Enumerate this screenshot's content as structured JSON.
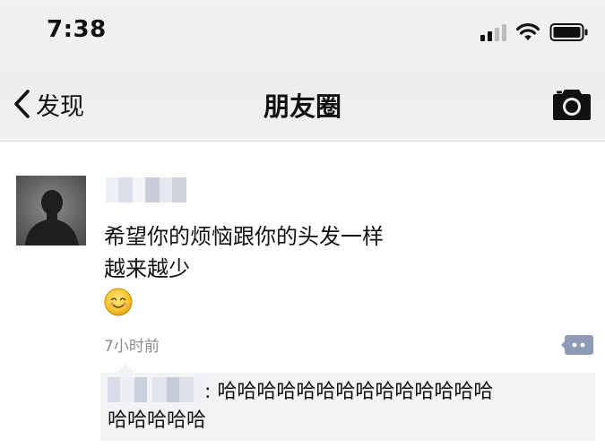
{
  "status_bar": {
    "time": "7:38"
  },
  "nav": {
    "back_label": "发现",
    "title": "朋友圈"
  },
  "post": {
    "text_line_1": "希望你的烦恼跟你的头发一样",
    "text_line_2": "越来越少",
    "emoji": "smiling-face",
    "time": "7小时前"
  },
  "comments": [
    {
      "separator": ":",
      "text_line_1": "哈哈哈哈哈哈哈哈哈哈哈哈哈哈",
      "text_line_2": "哈哈哈哈哈"
    }
  ],
  "colors": {
    "header_bg": "#f0f0f0",
    "comment_bg": "#f3f3f5",
    "timestamp_gray": "#8a8a8a",
    "wechat_link_blue": "#576b95"
  }
}
